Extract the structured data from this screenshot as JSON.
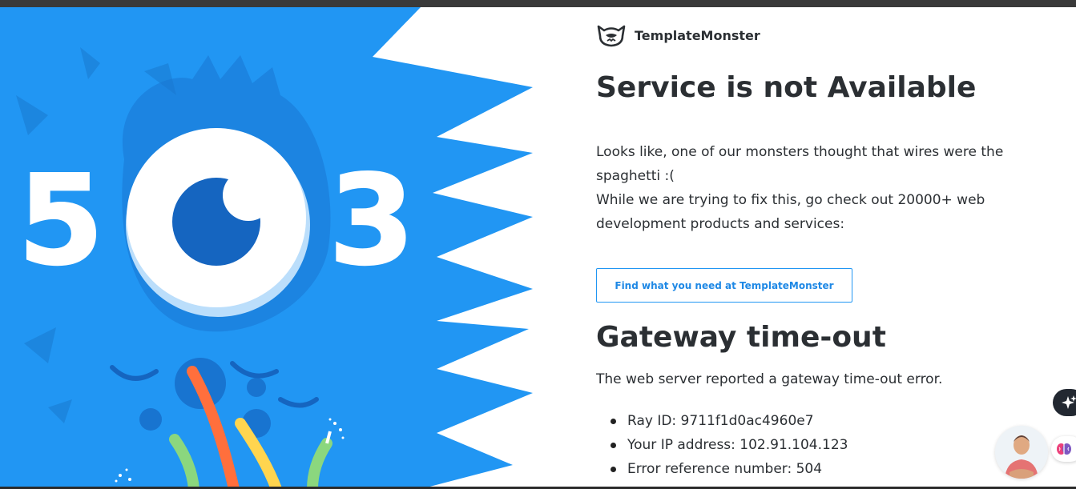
{
  "illustration": {
    "code": "503"
  },
  "brand": {
    "name": "TemplateMonster"
  },
  "main": {
    "title": "Service is not Available",
    "message_line1": "Looks like, one of our monsters thought that wires were the",
    "message_line2": "spaghetti :(",
    "message_line3": "While we are trying to fix this, go check out 20000+ web",
    "message_line4": "development products and services:",
    "cta_label": "Find what you need at TemplateMonster"
  },
  "error": {
    "title": "Gateway time-out",
    "description": "The web server reported a gateway time-out error.",
    "details": [
      "Ray ID: 9711f1d0ac4960e7",
      "Your IP address: 102.91.104.123",
      "Error reference number: 504"
    ]
  },
  "colors": {
    "accent": "#2196f3",
    "monster_blue": "#2196f3",
    "text": "#2b2f33"
  }
}
